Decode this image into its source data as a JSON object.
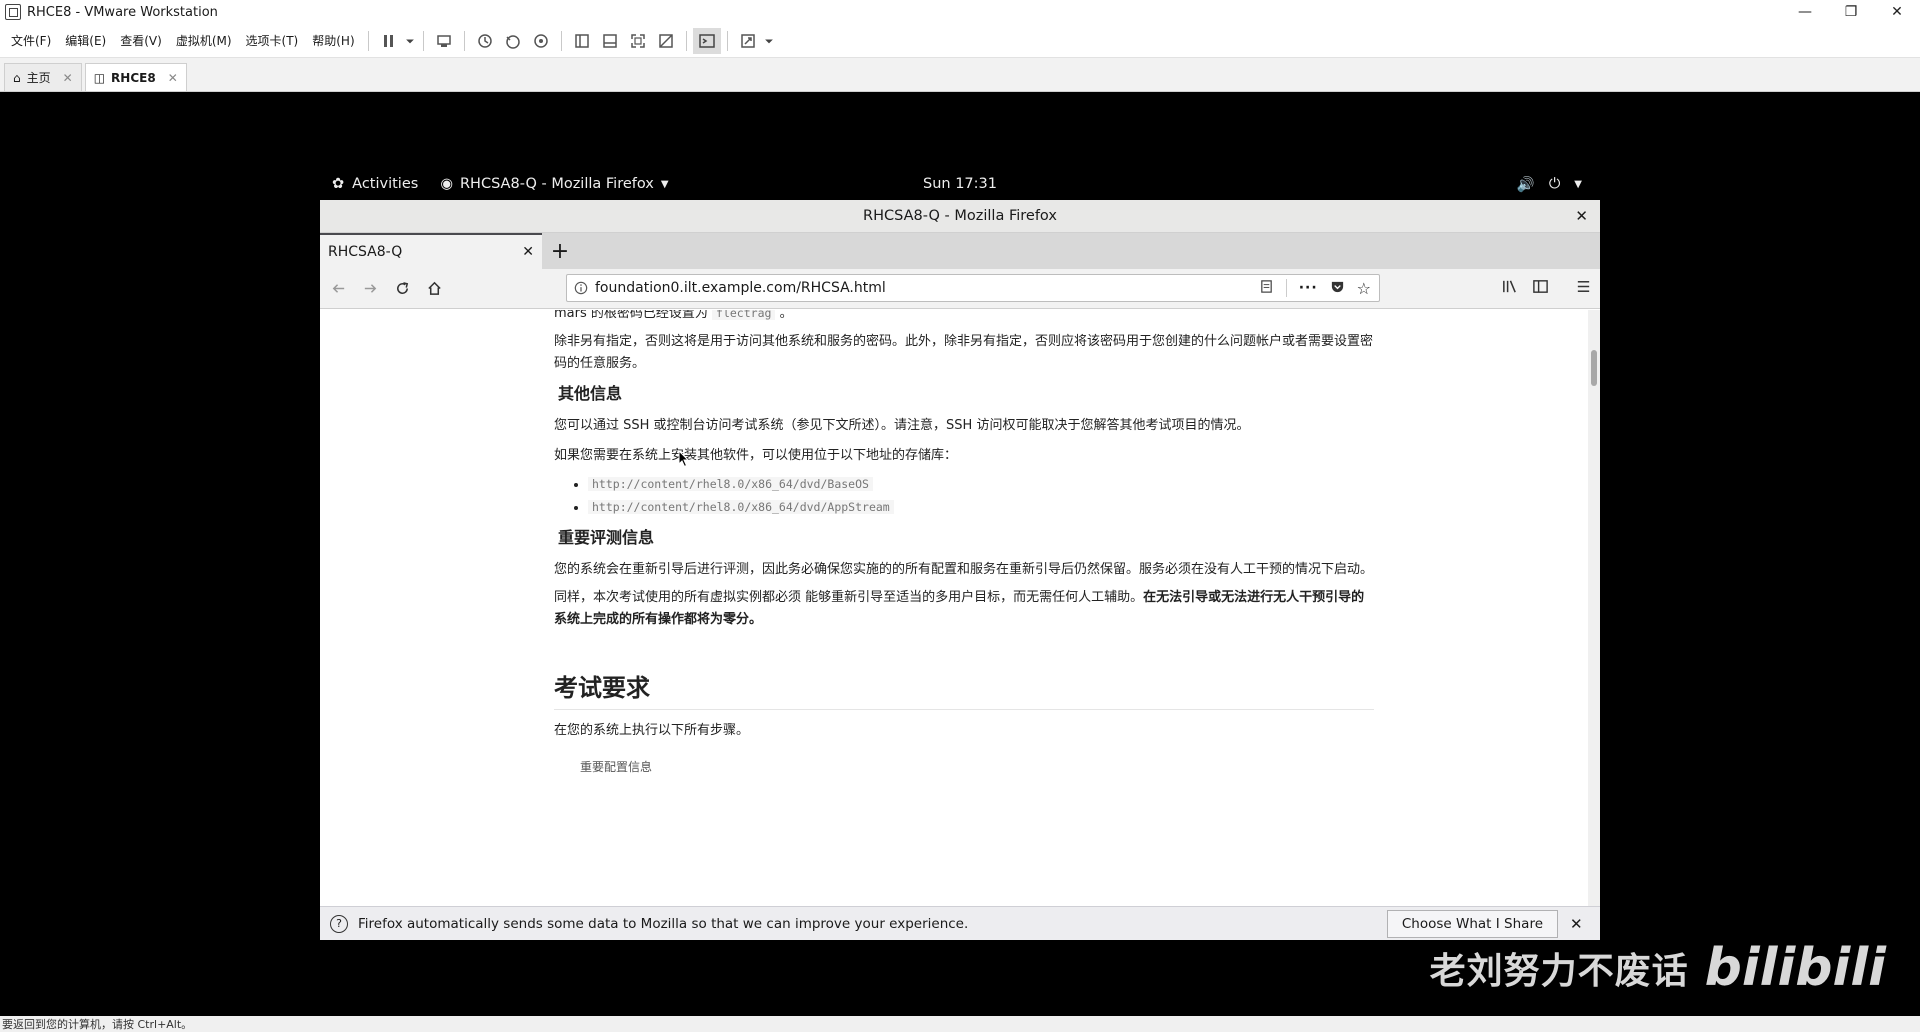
{
  "vmware": {
    "title": "RHCE8 - VMware Workstation",
    "menus": [
      "文件(F)",
      "编辑(E)",
      "查看(V)",
      "虚拟机(M)",
      "选项卡(T)",
      "帮助(H)"
    ],
    "tabs": [
      {
        "label": "主页"
      },
      {
        "label": "RHCE8"
      }
    ],
    "status": "要返回到您的计算机，请按 Ctrl+Alt。"
  },
  "gnome": {
    "activities": "Activities",
    "app_menu": "RHCSA8-Q - Mozilla Firefox",
    "clock": "Sun 17:31"
  },
  "firefox": {
    "window_title": "RHCSA8-Q - Mozilla Firefox",
    "tab_title": "RHCSA8-Q",
    "url": "foundation0.ilt.example.com/RHCSA.html",
    "notification": "Firefox automatically sends some data to Mozilla so that we can improve your experience.",
    "notification_button": "Choose What I Share"
  },
  "doc": {
    "line0_prefix": "mars 的根密码已经设置为",
    "line0_code": "flectrag",
    "line0_suffix": "。",
    "para1": "除非另有指定，否则这将是用于访问其他系统和服务的密码。此外，除非另有指定，否则应将该密码用于您创建的什么问题帐户或者需要设置密码的任意服务。",
    "h_other": "其他信息",
    "para2": "您可以通过 SSH 或控制台访问考试系统（参见下文所述）。请注意，SSH 访问权可能取决于您解答其他考试项目的情况。",
    "para3": "如果您需要在系统上安装其他软件，可以使用位于以下地址的存储库：",
    "repos": [
      "http://content/rhel8.0/x86_64/dvd/BaseOS",
      "http://content/rhel8.0/x86_64/dvd/AppStream"
    ],
    "h_eval": "重要评测信息",
    "para4": "您的系统会在重新引导后进行评测，因此务必确保您实施的的所有配置和服务在重新引导后仍然保留。服务必须在没有人工干预的情况下启动。",
    "para5_normal": "同样，本次考试使用的所有虚拟实例都必须 能够重新引导至适当的多用户目标，而无需任何人工辅助。",
    "para5_bold": "在无法引导或无法进行无人干预引导的系统上完成的所有操作都将为零分。",
    "h_req": "考试要求",
    "para6": "在您的系统上执行以下所有步骤。",
    "config_heading": "重要配置信息"
  },
  "watermark": {
    "text": "老刘努力不废话",
    "logo": "bilibili"
  }
}
